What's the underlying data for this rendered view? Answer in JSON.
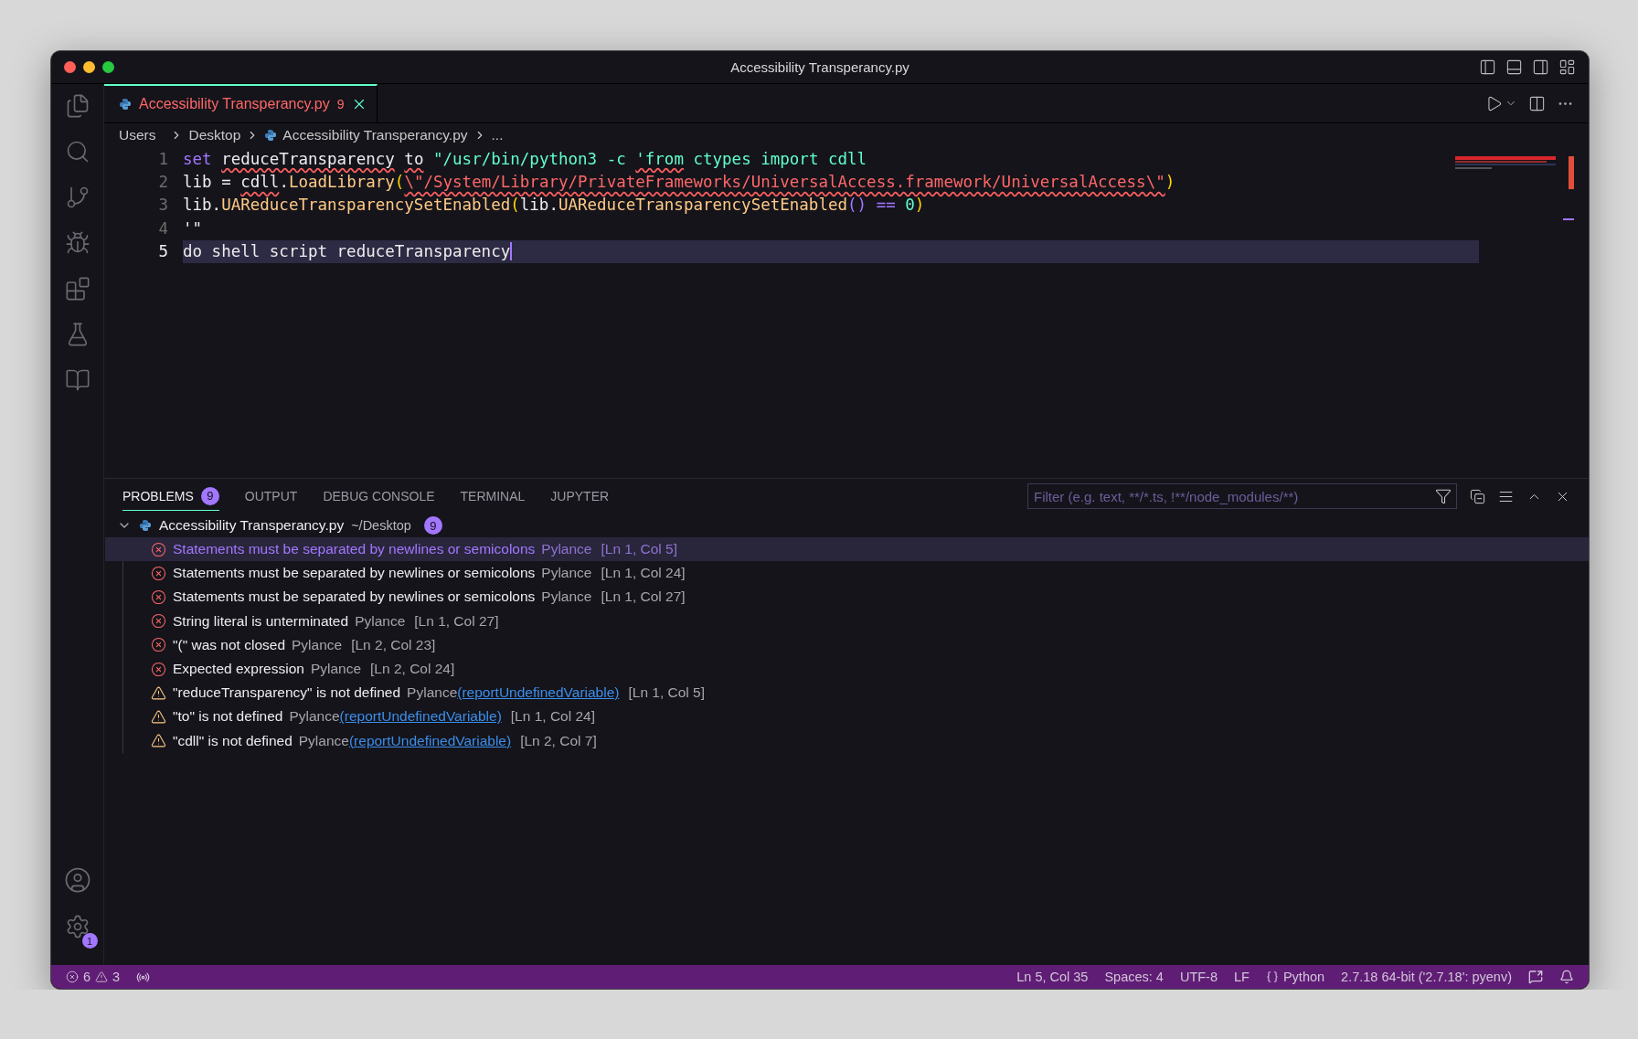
{
  "window": {
    "title": "Accessibility Transperancy.py"
  },
  "activity_bar": {
    "settings_badge": "1"
  },
  "editor_tab": {
    "label": "Accessibility Transperancy.py",
    "problem_count": "9",
    "selected": true
  },
  "breadcrumb": [
    "Users",
    "Desktop",
    "Accessibility Transperancy.py",
    "..."
  ],
  "code_lines": [
    {
      "number": "1",
      "current": false,
      "tokens": [
        {
          "kind": "keyword",
          "text": "set "
        },
        {
          "kind": "plain",
          "text": "reduceTransparency ",
          "squiggly": true
        },
        {
          "kind": "plain",
          "text": "to ",
          "squiggly": true
        },
        {
          "kind": "string",
          "text": "\"/usr/bin/python3 -c "
        },
        {
          "kind": "string",
          "text": "'from",
          "squiggly": true
        },
        {
          "kind": "string",
          "text": " ctypes import cdll"
        }
      ]
    },
    {
      "number": "2",
      "current": false,
      "tokens": [
        {
          "kind": "plain",
          "text": "lib = "
        },
        {
          "kind": "plain",
          "text": "cdll",
          "squiggly": true
        },
        {
          "kind": "plain",
          "text": "."
        },
        {
          "kind": "function",
          "text": "LoadLibrary"
        },
        {
          "kind": "bracket",
          "text": "("
        },
        {
          "kind": "invalid",
          "text": "\\\"/System/Library/PrivateFrameworks/UniversalAccess.framework/UniversalAccess\\\"",
          "squiggly": true
        },
        {
          "kind": "bracket",
          "text": ")"
        }
      ]
    },
    {
      "number": "3",
      "current": false,
      "tokens": [
        {
          "kind": "plain",
          "text": "lib."
        },
        {
          "kind": "function",
          "text": "UAReduceTransparencySetEnabled"
        },
        {
          "kind": "bracket",
          "text": "("
        },
        {
          "kind": "plain",
          "text": "lib."
        },
        {
          "kind": "function",
          "text": "UAReduceTransparencySetEnabled"
        },
        {
          "kind": "operator",
          "text": "() "
        },
        {
          "kind": "operator",
          "text": "== "
        },
        {
          "kind": "number",
          "text": "0"
        },
        {
          "kind": "bracket",
          "text": ")"
        }
      ]
    },
    {
      "number": "4",
      "current": false,
      "tokens": [
        {
          "kind": "plain",
          "text": "'\""
        }
      ]
    },
    {
      "number": "5",
      "current": true,
      "tokens": [
        {
          "kind": "plain",
          "text": "do shell script reduceTransparency"
        }
      ]
    }
  ],
  "panel": {
    "tabs": [
      {
        "label": "PROBLEMS",
        "badge": "9",
        "selected": true
      },
      {
        "label": "OUTPUT",
        "selected": false
      },
      {
        "label": "DEBUG CONSOLE",
        "selected": false
      },
      {
        "label": "TERMINAL",
        "selected": false
      },
      {
        "label": "JUPYTER",
        "selected": false
      }
    ],
    "filter": {
      "placeholder": "Filter (e.g. text, **/*.ts, !**/node_modules/**)"
    },
    "problem_group": {
      "file": "Accessibility Transperancy.py",
      "path": "~/Desktop",
      "count": "9",
      "expanded": true,
      "items": [
        {
          "kind": "error",
          "message": "Statements must be separated by newlines or semicolons",
          "source": "Pylance",
          "location": "[Ln 1, Col 5]",
          "selected": true
        },
        {
          "kind": "error",
          "message": "Statements must be separated by newlines or semicolons",
          "source": "Pylance",
          "location": "[Ln 1, Col 24]",
          "selected": false
        },
        {
          "kind": "error",
          "message": "Statements must be separated by newlines or semicolons",
          "source": "Pylance",
          "location": "[Ln 1, Col 27]",
          "selected": false
        },
        {
          "kind": "error",
          "message": "String literal is unterminated",
          "source": "Pylance",
          "location": "[Ln 1, Col 27]",
          "selected": false
        },
        {
          "kind": "error",
          "message": "\"(\" was not closed",
          "source": "Pylance",
          "location": "[Ln 2, Col 23]",
          "selected": false
        },
        {
          "kind": "error",
          "message": "Expected expression",
          "source": "Pylance",
          "location": "[Ln 2, Col 24]",
          "selected": false
        },
        {
          "kind": "warning",
          "message": "\"reduceTransparency\" is not defined",
          "source": "Pylance",
          "code": "(reportUndefinedVariable)",
          "location": "[Ln 1, Col 5]",
          "selected": false
        },
        {
          "kind": "warning",
          "message": "\"to\" is not defined",
          "source": "Pylance",
          "code": "(reportUndefinedVariable)",
          "location": "[Ln 1, Col 24]",
          "selected": false
        },
        {
          "kind": "warning",
          "message": "\"cdll\" is not defined",
          "source": "Pylance",
          "code": "(reportUndefinedVariable)",
          "location": "[Ln 2, Col 7]",
          "selected": false
        }
      ]
    }
  },
  "status_bar": {
    "errors": "6",
    "warnings": "3",
    "items": [
      {
        "kind": "plain",
        "text": "Ln 5, Col 35"
      },
      {
        "kind": "plain",
        "text": "Spaces: 4"
      },
      {
        "kind": "plain",
        "text": "UTF-8"
      },
      {
        "kind": "plain",
        "text": "LF"
      },
      {
        "kind": "language",
        "text": "Python"
      },
      {
        "kind": "plain",
        "text": "2.7.18 64-bit ('2.7.18': pyenv)"
      }
    ]
  }
}
